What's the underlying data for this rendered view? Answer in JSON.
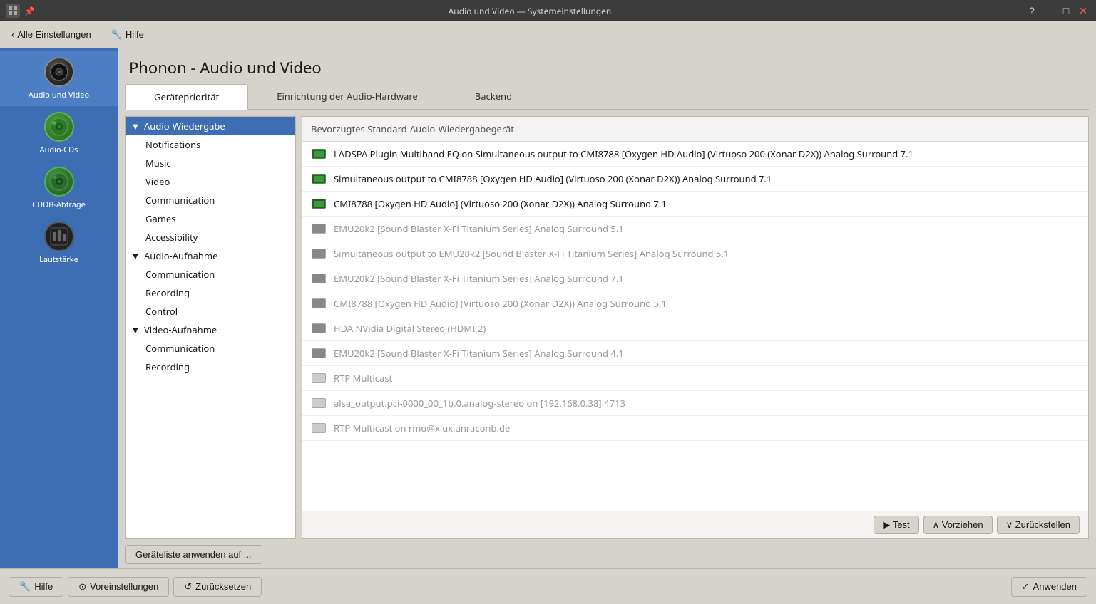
{
  "window": {
    "title": "Audio und Video — Systemeinstellungen"
  },
  "toolbar": {
    "back_label": "Alle Einstellungen",
    "help_label": "Hilfe"
  },
  "page": {
    "title": "Phonon - Audio und Video"
  },
  "tabs": [
    {
      "id": "geraet",
      "label": "Gerätepriorität",
      "active": true
    },
    {
      "id": "einrichtung",
      "label": "Einrichtung der Audio-Hardware",
      "active": false
    },
    {
      "id": "backend",
      "label": "Backend",
      "active": false
    }
  ],
  "sidebar": {
    "items": [
      {
        "id": "audio-video",
        "label": "Audio und Video",
        "active": true
      },
      {
        "id": "audio-cds",
        "label": "Audio-CDs",
        "active": false
      },
      {
        "id": "cddb",
        "label": "CDDB-Abfrage",
        "active": false
      },
      {
        "id": "lautstarke",
        "label": "Lautstärke",
        "active": false
      }
    ]
  },
  "tree": {
    "items": [
      {
        "id": "audio-wiedergabe",
        "label": "Audio-Wiedergabe",
        "level": "parent",
        "selected": true,
        "expanded": true
      },
      {
        "id": "notifications",
        "label": "Notifications",
        "level": "child"
      },
      {
        "id": "music",
        "label": "Music",
        "level": "child"
      },
      {
        "id": "video",
        "label": "Video",
        "level": "child"
      },
      {
        "id": "communication1",
        "label": "Communication",
        "level": "child"
      },
      {
        "id": "games",
        "label": "Games",
        "level": "child"
      },
      {
        "id": "accessibility",
        "label": "Accessibility",
        "level": "child"
      },
      {
        "id": "audio-aufnahme",
        "label": "Audio-Aufnahme",
        "level": "parent",
        "expanded": true
      },
      {
        "id": "communication2",
        "label": "Communication",
        "level": "child"
      },
      {
        "id": "recording1",
        "label": "Recording",
        "level": "child"
      },
      {
        "id": "control",
        "label": "Control",
        "level": "child"
      },
      {
        "id": "video-aufnahme",
        "label": "Video-Aufnahme",
        "level": "parent",
        "expanded": true
      },
      {
        "id": "communication3",
        "label": "Communication",
        "level": "child"
      },
      {
        "id": "recording2",
        "label": "Recording",
        "level": "child"
      }
    ]
  },
  "device_panel": {
    "header": "Bevorzugtes Standard-Audio-Wiedergabegerät",
    "devices": [
      {
        "id": 1,
        "label": "LADSPA Plugin Multiband EQ on Simultaneous output to CMI8788 [Oxygen HD Audio] (Virtuoso 200 (Xonar D2X)) Analog Surround 7.1",
        "icon": "green",
        "enabled": true
      },
      {
        "id": 2,
        "label": "Simultaneous output to CMI8788 [Oxygen HD Audio] (Virtuoso 200 (Xonar D2X)) Analog Surround 7.1",
        "icon": "green",
        "enabled": true
      },
      {
        "id": 3,
        "label": "CMI8788 [Oxygen HD Audio] (Virtuoso 200 (Xonar D2X)) Analog Surround 7.1",
        "icon": "green",
        "enabled": true
      },
      {
        "id": 4,
        "label": "EMU20k2 [Sound Blaster X-Fi Titanium Series] Analog Surround 5.1",
        "icon": "gray",
        "enabled": false
      },
      {
        "id": 5,
        "label": "Simultaneous output to EMU20k2 [Sound Blaster X-Fi Titanium Series] Analog Surround 5.1",
        "icon": "gray",
        "enabled": false
      },
      {
        "id": 6,
        "label": "EMU20k2 [Sound Blaster X-Fi Titanium Series] Analog Surround 7.1",
        "icon": "gray",
        "enabled": false
      },
      {
        "id": 7,
        "label": "CMI8788 [Oxygen HD Audio] (Virtuoso 200 (Xonar D2X)) Analog Surround 5.1",
        "icon": "gray",
        "enabled": false
      },
      {
        "id": 8,
        "label": "HDA NVidia Digital Stereo (HDMI 2)",
        "icon": "gray",
        "enabled": false
      },
      {
        "id": 9,
        "label": "EMU20k2 [Sound Blaster X-Fi Titanium Series] Analog Surround 4.1",
        "icon": "gray",
        "enabled": false
      },
      {
        "id": 10,
        "label": "RTP Multicast",
        "icon": "light-gray",
        "enabled": false
      },
      {
        "id": 11,
        "label": "alsa_output.pci-0000_00_1b.0.analog-stereo on [192.168.0.38]:4713",
        "icon": "light-gray",
        "enabled": false
      },
      {
        "id": 12,
        "label": "RTP Multicast on rmo@xlux.anraconb.de",
        "icon": "light-gray",
        "enabled": false
      }
    ]
  },
  "actions": {
    "geraete_btn": "Geräteliste anwenden auf ...",
    "test_btn": "▶ Test",
    "vorziehen_btn": "∧ Vorziehen",
    "zurueckstellen_btn": "∨ Zurückstellen"
  },
  "bottom": {
    "hilfe_btn": "Hilfe",
    "voreinstellungen_btn": "Voreinstellungen",
    "zuruecksetzen_btn": "Zurücksetzen",
    "anwenden_btn": "Anwenden"
  }
}
